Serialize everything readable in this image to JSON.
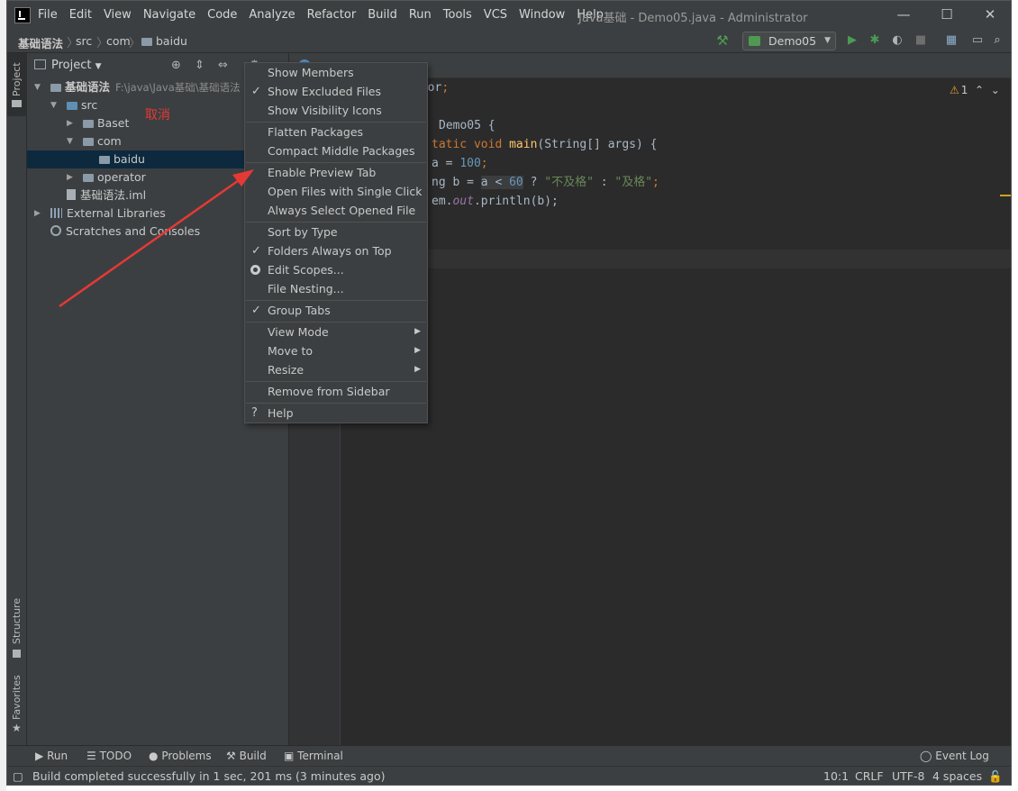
{
  "menu": [
    "File",
    "Edit",
    "View",
    "Navigate",
    "Code",
    "Analyze",
    "Refactor",
    "Build",
    "Run",
    "Tools",
    "VCS",
    "Window",
    "Help"
  ],
  "window_title": "Java基础 - Demo05.java - Administrator",
  "breadcrumb": [
    "基础语法",
    "src",
    "com",
    "baidu"
  ],
  "run_config": "Demo05",
  "left_stripe": {
    "project": "Project",
    "structure": "Structure",
    "favorites": "Favorites"
  },
  "project": {
    "title": "Project",
    "tree": [
      {
        "label": "基础语法",
        "path": "F:\\java\\Java基础\\基础语法"
      },
      {
        "label": "src"
      },
      {
        "label": "Baset"
      },
      {
        "label": "com"
      },
      {
        "label": "baidu"
      },
      {
        "label": "operator"
      },
      {
        "label": "基础语法.iml"
      },
      {
        "label": "External Libraries"
      },
      {
        "label": "Scratches and Consoles"
      }
    ],
    "annotation": "取消"
  },
  "editor": {
    "warning_count": "1",
    "code": {
      "l1a": "ator",
      "l1b": ";",
      "l2a": "Demo05 {",
      "l3a": "tatic ",
      "l3b": "void ",
      "l3c": "main",
      "l3d": "(String[] args) {",
      "l4a": "a = ",
      "l4b": "100",
      "l4c": ";",
      "l5a": "ng b = ",
      "l5b": "a < ",
      "l5c": "60",
      "l5d": " ? ",
      "l5e": "\"不及格\"",
      "l5f": " : ",
      "l5g": "\"及格\"",
      "l5h": ";",
      "l6a": "em.",
      "l6b": "out",
      "l6c": ".println(b);"
    }
  },
  "context_menu": [
    {
      "label": "Show Members",
      "mark": ""
    },
    {
      "label": "Show Excluded Files",
      "mark": "check"
    },
    {
      "label": "Show Visibility Icons",
      "mark": ""
    },
    {
      "label": "Flatten Packages",
      "mark": ""
    },
    {
      "label": "Compact Middle Packages",
      "mark": ""
    },
    {
      "label": "Enable Preview Tab",
      "mark": ""
    },
    {
      "label": "Open Files with Single Click",
      "mark": ""
    },
    {
      "label": "Always Select Opened File",
      "mark": ""
    },
    {
      "label": "Sort by Type",
      "mark": ""
    },
    {
      "label": "Folders Always on Top",
      "mark": "check"
    },
    {
      "label": "Edit Scopes...",
      "mark": "radio"
    },
    {
      "label": "File Nesting...",
      "mark": ""
    },
    {
      "label": "Group Tabs",
      "mark": "check"
    },
    {
      "label": "View Mode",
      "mark": "submenu"
    },
    {
      "label": "Move to",
      "mark": "submenu"
    },
    {
      "label": "Resize",
      "mark": "submenu"
    },
    {
      "label": "Remove from Sidebar",
      "mark": ""
    },
    {
      "label": "Help",
      "mark": "help"
    }
  ],
  "bottom_tools": [
    "Run",
    "TODO",
    "Problems",
    "Build",
    "Terminal",
    "Event Log"
  ],
  "status": {
    "message": "Build completed successfully in 1 sec, 201 ms (3 minutes ago)",
    "position": "10:1",
    "line_sep": "CRLF",
    "encoding": "UTF-8",
    "indent": "4 spaces"
  },
  "colors": {
    "accent_red": "#e53935",
    "selection": "#0d293e",
    "run_green": "#499c54"
  }
}
